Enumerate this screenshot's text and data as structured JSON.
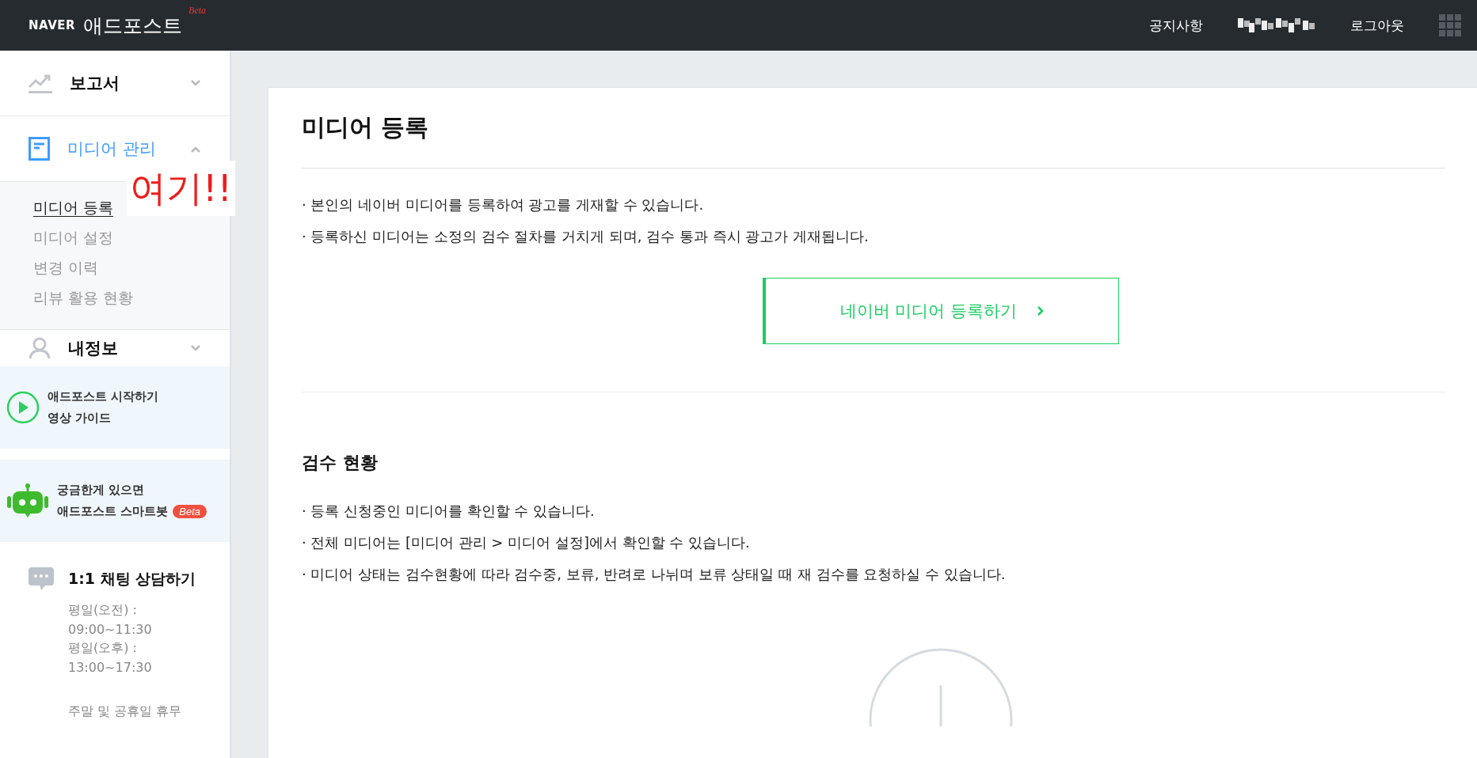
{
  "header": {
    "logo": "NAVER",
    "service": "애드포스트",
    "badge": "Beta",
    "links": [
      {
        "kind": "text",
        "label": "공지사항"
      },
      {
        "kind": "redacted"
      },
      {
        "kind": "text",
        "label": "로그아웃"
      }
    ]
  },
  "sidebar": {
    "menus": [
      {
        "label": "보고서",
        "expanded": false,
        "selected": false
      },
      {
        "label": "미디어 관리",
        "expanded": true,
        "selected": true,
        "children": [
          {
            "label": "미디어 등록",
            "selected": true
          },
          {
            "label": "미디어 설정",
            "selected": false
          },
          {
            "label": "변경 이력",
            "selected": false
          },
          {
            "label": "리뷰 활용 현황",
            "selected": false
          }
        ]
      },
      {
        "label": "내정보",
        "expanded": false,
        "selected": false
      }
    ],
    "guide": {
      "lines": [
        "애드포스트 시작하기",
        "영상 가이드"
      ]
    },
    "bot": {
      "lines": [
        "궁금한게 있으면",
        "애드포스트 스마트봇"
      ],
      "badge": "Beta"
    },
    "chat": {
      "title": "1:1 채팅 상담하기",
      "hours": [
        "평일(오전) :",
        "09:00~11:30",
        "평일(오후) :",
        "13:00~17:30"
      ],
      "note": "주말 및 공휴일 휴무"
    }
  },
  "annotation": "여기!!",
  "main": {
    "title": "미디어 등록",
    "notes": [
      "·  본인의 네이버 미디어를 등록하여 광고를 게재할 수 있습니다.",
      "·  등록하신 미디어는 소정의 검수 절차를 거치게 되며, 검수 통과 즉시 광고가 게재됩니다."
    ],
    "register_button": "네이버 미디어 등록하기",
    "review": {
      "title": "검수 현황",
      "notes": [
        "·  등록 신청중인 미디어를 확인할 수 있습니다.",
        "·  전체 미디어는 [미디어 관리 > 미디어 설정]에서 확인할 수 있습니다.",
        "·  미디어 상태는 검수현황에 따라 검수중, 보류, 반려로 나뉘며 보류 상태일 때 재 검수를 요청하실 수 있습니다."
      ]
    }
  }
}
